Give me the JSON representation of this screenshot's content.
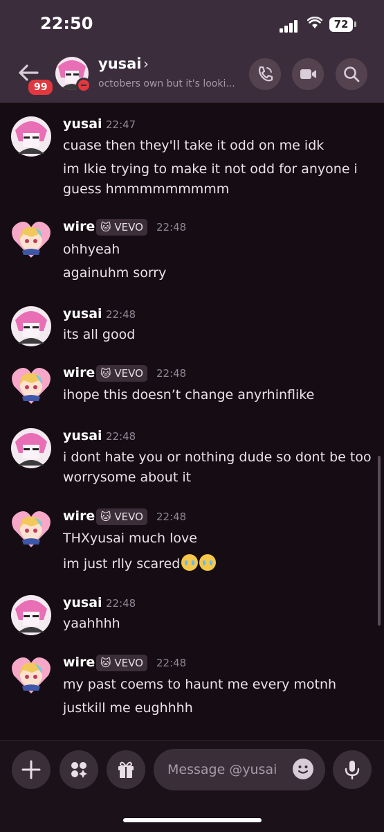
{
  "status_bar": {
    "time": "22:50",
    "battery": "72"
  },
  "header": {
    "unread_badge": "99",
    "name": "yusai",
    "chevron": "›",
    "custom_status": "octobers own but it's looki...",
    "buttons": [
      "voice-call",
      "video-call",
      "search"
    ]
  },
  "messages": [
    {
      "author": "yusai",
      "tag": "",
      "time": "22:47",
      "lines": [
        "cuase then they'll take it odd on me idk",
        "im lkie trying to make it not odd for anyone i",
        "guess hmmmmmmmmm"
      ]
    },
    {
      "author": "wire",
      "tag": "VEVO",
      "time": "22:48",
      "lines": [
        "ohhyeah",
        "againuhm sorry"
      ]
    },
    {
      "author": "yusai",
      "tag": "",
      "time": "22:48",
      "lines": [
        "its all good"
      ]
    },
    {
      "author": "wire",
      "tag": "VEVO",
      "time": "22:48",
      "lines": [
        "ihope this doesn’t change anyrhinflike"
      ]
    },
    {
      "author": "yusai",
      "tag": "",
      "time": "22:48",
      "lines": [
        "i dont hate you or nothing dude so dont be too",
        "worrysome about it"
      ]
    },
    {
      "author": "wire",
      "tag": "VEVO",
      "time": "22:48",
      "lines": [
        "THXyusai much love",
        "im just rlly scared"
      ]
    },
    {
      "author": "yusai",
      "tag": "",
      "time": "22:48",
      "lines": [
        "yaahhhh"
      ]
    },
    {
      "author": "wire",
      "tag": "VEVO",
      "time": "22:48",
      "lines": [
        "my past coems to haunt me every motnh",
        "justkill me eughhhh"
      ]
    }
  ],
  "composer": {
    "placeholder": "Message @yusai"
  },
  "colors": {
    "header_bg": "#3b2d3c",
    "chat_bg": "#160d14",
    "badge_red": "#e0383e",
    "tag_bg": "#3c2e39"
  }
}
